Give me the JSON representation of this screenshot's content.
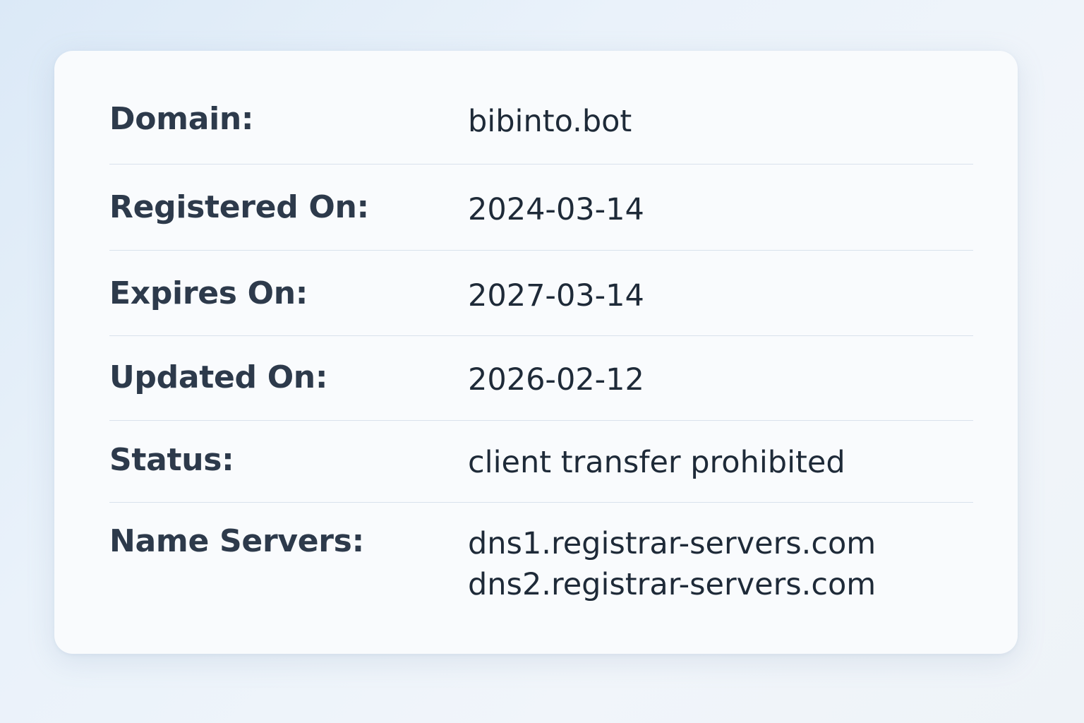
{
  "whois": {
    "rows": [
      {
        "label": "Domain:",
        "value": "bibinto.bot"
      },
      {
        "label": "Registered On:",
        "value": "2024-03-14"
      },
      {
        "label": "Expires On:",
        "value": "2027-03-14"
      },
      {
        "label": "Updated On:",
        "value": "2026-02-12"
      },
      {
        "label": "Status:",
        "value": "client transfer prohibited"
      },
      {
        "label": "Name Servers:",
        "values": [
          "dns1.registrar-servers.com",
          "dns2.registrar-servers.com"
        ]
      }
    ]
  },
  "colors": {
    "label": "#2d3a4b",
    "value": "#1e2a38",
    "divider": "#d9e2ec",
    "card": "#f9fbfd"
  }
}
